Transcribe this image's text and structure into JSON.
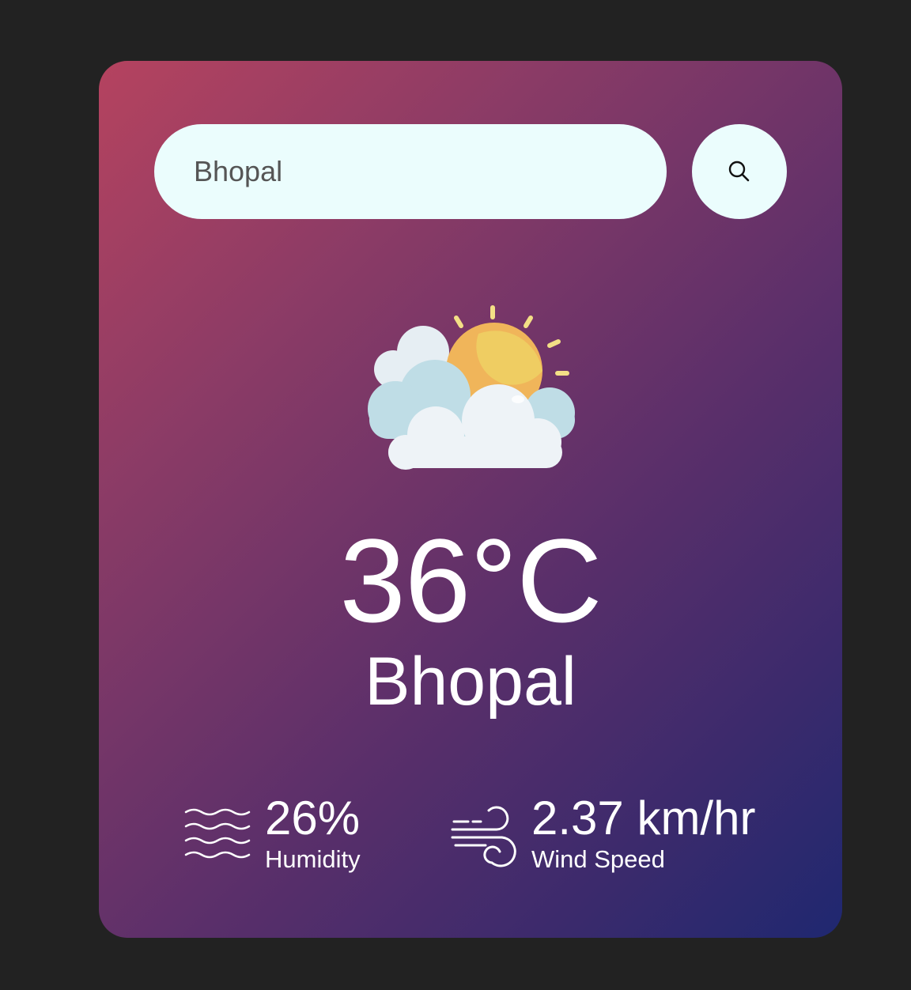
{
  "search": {
    "value": "Bhopal",
    "icon": "search-icon"
  },
  "weather": {
    "icon": "partly-cloudy-icon",
    "temperature": "36°C",
    "city": "Bhopal"
  },
  "humidity": {
    "icon": "humidity-icon",
    "value": "26%",
    "label": "Humidity"
  },
  "wind": {
    "icon": "wind-icon",
    "value": "2.37 km/hr",
    "label": "Wind Speed"
  },
  "colors": {
    "page_background": "#222222",
    "gradient_start": "#b5435f",
    "gradient_end": "#1f2870",
    "search_background": "#ebfdfd",
    "text": "#ffffff"
  }
}
